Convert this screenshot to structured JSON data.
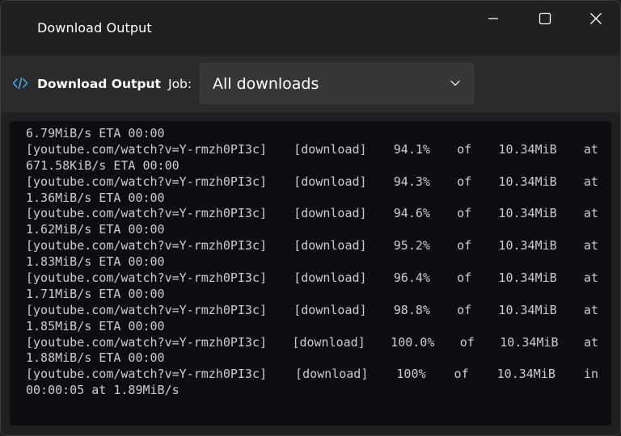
{
  "window": {
    "title": "Download Output",
    "controls": {
      "minimize": "minimize-icon",
      "maximize": "maximize-icon",
      "close": "close-icon"
    }
  },
  "toolbar": {
    "icon": "code-icon",
    "title": "Download Output",
    "job_label": "Job:",
    "job_selected": "All downloads",
    "accent_color": "#4aa3e0"
  },
  "terminal": {
    "lines": [
      {
        "cells": [
          "6.79MiB/s ETA 00:00"
        ]
      },
      {
        "cells": [
          "[youtube.com/watch?v=Y-rmzh0PI3c]",
          "[download]",
          "94.1%",
          "of",
          "10.34MiB",
          "at"
        ]
      },
      {
        "cells": [
          "671.58KiB/s ETA 00:00"
        ]
      },
      {
        "cells": [
          "[youtube.com/watch?v=Y-rmzh0PI3c]",
          "[download]",
          "94.3%",
          "of",
          "10.34MiB",
          "at"
        ]
      },
      {
        "cells": [
          "1.36MiB/s ETA 00:00"
        ]
      },
      {
        "cells": [
          "[youtube.com/watch?v=Y-rmzh0PI3c]",
          "[download]",
          "94.6%",
          "of",
          "10.34MiB",
          "at"
        ]
      },
      {
        "cells": [
          "1.62MiB/s ETA 00:00"
        ]
      },
      {
        "cells": [
          "[youtube.com/watch?v=Y-rmzh0PI3c]",
          "[download]",
          "95.2%",
          "of",
          "10.34MiB",
          "at"
        ]
      },
      {
        "cells": [
          "1.83MiB/s ETA 00:00"
        ]
      },
      {
        "cells": [
          "[youtube.com/watch?v=Y-rmzh0PI3c]",
          "[download]",
          "96.4%",
          "of",
          "10.34MiB",
          "at"
        ]
      },
      {
        "cells": [
          "1.71MiB/s ETA 00:00"
        ]
      },
      {
        "cells": [
          "[youtube.com/watch?v=Y-rmzh0PI3c]",
          "[download]",
          "98.8%",
          "of",
          "10.34MiB",
          "at"
        ]
      },
      {
        "cells": [
          "1.85MiB/s ETA 00:00"
        ]
      },
      {
        "cells": [
          "[youtube.com/watch?v=Y-rmzh0PI3c]",
          "[download]",
          "100.0%",
          "of",
          "10.34MiB",
          "at"
        ]
      },
      {
        "cells": [
          "1.88MiB/s ETA 00:00"
        ]
      },
      {
        "cells": [
          "[youtube.com/watch?v=Y-rmzh0PI3c]",
          "[download]",
          "100%",
          "of",
          "10.34MiB",
          "in"
        ]
      },
      {
        "cells": [
          "00:00:05 at 1.89MiB/s"
        ]
      }
    ]
  }
}
